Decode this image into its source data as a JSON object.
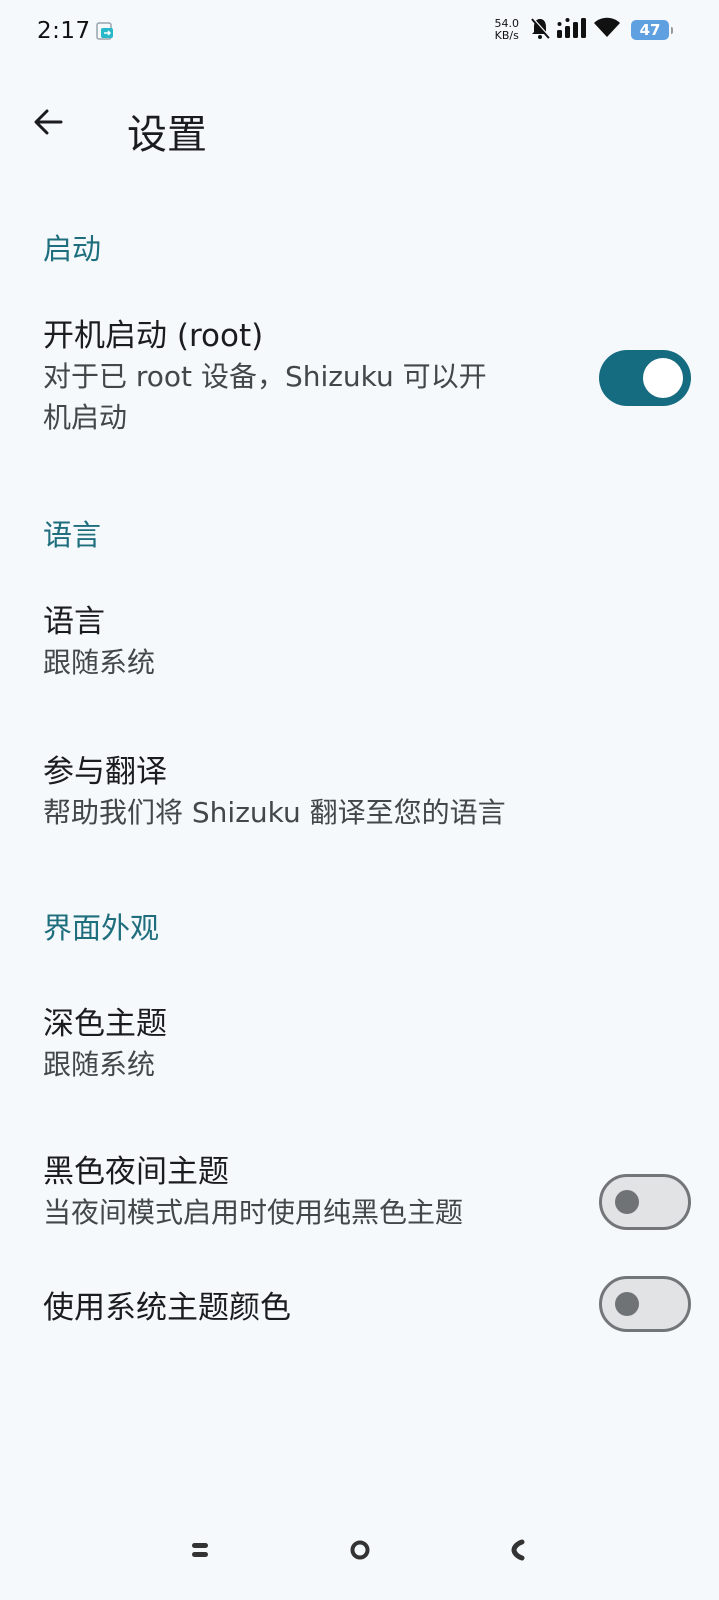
{
  "status_bar": {
    "time": "2:17",
    "net_speed_value": "54.0",
    "net_speed_unit": "KB/s",
    "battery_level": "47",
    "icons": [
      "app-notification-icon",
      "silent-bell-icon",
      "signal-icon",
      "wifi-icon",
      "battery-icon"
    ]
  },
  "app_bar": {
    "title": "设置",
    "back_icon": "arrow-back-icon"
  },
  "sections": {
    "startup": {
      "header": "启动",
      "boot_start": {
        "title": "开机启动 (root)",
        "summary_line1": "对于已 root 设备，Shizuku 可以开",
        "summary_line2": "机启动",
        "enabled": true
      }
    },
    "language": {
      "header": "语言",
      "language_pref": {
        "title": "语言",
        "summary": "跟随系统"
      },
      "translate_pref": {
        "title": "参与翻译",
        "summary": "帮助我们将 Shizuku 翻译至您的语言"
      }
    },
    "appearance": {
      "header": "界面外观",
      "dark_theme": {
        "title": "深色主题",
        "summary": "跟随系统"
      },
      "black_night_theme": {
        "title": "黑色夜间主题",
        "summary": "当夜间模式启用时使用纯黑色主题",
        "enabled": false
      },
      "system_colors": {
        "title": "使用系统主题颜色",
        "enabled": false
      }
    }
  },
  "nav_bar": {
    "icons": [
      "recents-icon",
      "home-icon",
      "back-icon"
    ]
  },
  "colors": {
    "accent": "#1e6e7d",
    "switch_on": "#156b80",
    "background": "#f5f9fc"
  }
}
